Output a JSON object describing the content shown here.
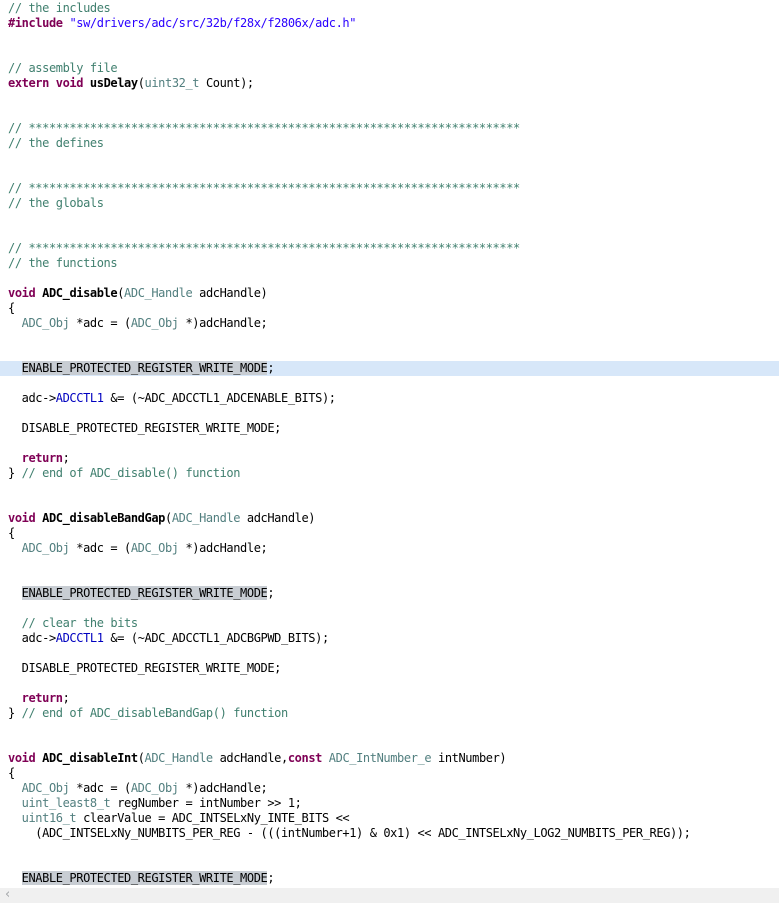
{
  "app": {
    "kind": "code-editor",
    "language": "C",
    "file_topic": "TI f2806x ADC driver source"
  },
  "palette": {
    "keyword": "#7F0055",
    "comment": "#3F7F6E",
    "string": "#2A00FF",
    "typedef": "#527F7F",
    "field": "#0000C0",
    "occurrence_bg": "#C8CDD3",
    "current_line_bg": "#D7E7F9",
    "scrollbar_bg": "#F0F0F0"
  },
  "scrollbar": {
    "left_arrow": "‹"
  },
  "editor": {
    "lines": [
      {
        "tokens": [
          [
            "com",
            "// the includes"
          ]
        ]
      },
      {
        "tokens": [
          [
            "kw",
            "#include"
          ],
          [
            "pl",
            " "
          ],
          [
            "str",
            "\"sw/drivers/adc/src/32b/f28x/f2806x/adc.h\""
          ]
        ]
      },
      {
        "tokens": []
      },
      {
        "tokens": []
      },
      {
        "tokens": [
          [
            "com",
            "// assembly file"
          ]
        ]
      },
      {
        "tokens": [
          [
            "kw",
            "extern"
          ],
          [
            "pl",
            " "
          ],
          [
            "kw",
            "void"
          ],
          [
            "pl",
            " "
          ],
          [
            "fn",
            "usDelay"
          ],
          [
            "pl",
            "("
          ],
          [
            "typ",
            "uint32_t"
          ],
          [
            "pl",
            " Count);"
          ]
        ]
      },
      {
        "tokens": []
      },
      {
        "tokens": []
      },
      {
        "tokens": [
          [
            "com",
            "// ************************************************************************"
          ]
        ]
      },
      {
        "tokens": [
          [
            "com",
            "// the defines"
          ]
        ]
      },
      {
        "tokens": []
      },
      {
        "tokens": []
      },
      {
        "tokens": [
          [
            "com",
            "// ************************************************************************"
          ]
        ]
      },
      {
        "tokens": [
          [
            "com",
            "// the globals"
          ]
        ]
      },
      {
        "tokens": []
      },
      {
        "tokens": []
      },
      {
        "tokens": [
          [
            "com",
            "// ************************************************************************"
          ]
        ]
      },
      {
        "tokens": [
          [
            "com",
            "// the functions"
          ]
        ]
      },
      {
        "tokens": []
      },
      {
        "tokens": [
          [
            "kw",
            "void"
          ],
          [
            "pl",
            " "
          ],
          [
            "fn",
            "ADC_disable"
          ],
          [
            "pl",
            "("
          ],
          [
            "typ",
            "ADC_Handle"
          ],
          [
            "pl",
            " adcHandle)"
          ]
        ]
      },
      {
        "tokens": [
          [
            "pl",
            "{"
          ]
        ]
      },
      {
        "tokens": [
          [
            "pl",
            "  "
          ],
          [
            "typ",
            "ADC_Obj"
          ],
          [
            "pl",
            " *adc = ("
          ],
          [
            "typ",
            "ADC_Obj"
          ],
          [
            "pl",
            " *)adcHandle;"
          ]
        ]
      },
      {
        "tokens": []
      },
      {
        "tokens": []
      },
      {
        "highlight": "line",
        "tokens": [
          [
            "pl",
            "  "
          ],
          [
            "occ",
            "ENABLE_PROTECTED_REGISTER_WRITE_MODE"
          ],
          [
            "pl",
            ";"
          ]
        ]
      },
      {
        "tokens": []
      },
      {
        "tokens": [
          [
            "pl",
            "  adc->"
          ],
          [
            "field",
            "ADCCTL1"
          ],
          [
            "pl",
            " &= (~ADC_ADCCTL1_ADCENABLE_BITS);"
          ]
        ]
      },
      {
        "tokens": []
      },
      {
        "tokens": [
          [
            "pl",
            "  DISABLE_PROTECTED_REGISTER_WRITE_MODE;"
          ]
        ]
      },
      {
        "tokens": []
      },
      {
        "tokens": [
          [
            "pl",
            "  "
          ],
          [
            "kw",
            "return"
          ],
          [
            "pl",
            ";"
          ]
        ]
      },
      {
        "tokens": [
          [
            "pl",
            "} "
          ],
          [
            "com",
            "// end of ADC_disable() function"
          ]
        ]
      },
      {
        "tokens": []
      },
      {
        "tokens": []
      },
      {
        "tokens": [
          [
            "kw",
            "void"
          ],
          [
            "pl",
            " "
          ],
          [
            "fn",
            "ADC_disableBandGap"
          ],
          [
            "pl",
            "("
          ],
          [
            "typ",
            "ADC_Handle"
          ],
          [
            "pl",
            " adcHandle)"
          ]
        ]
      },
      {
        "tokens": [
          [
            "pl",
            "{"
          ]
        ]
      },
      {
        "tokens": [
          [
            "pl",
            "  "
          ],
          [
            "typ",
            "ADC_Obj"
          ],
          [
            "pl",
            " *adc = ("
          ],
          [
            "typ",
            "ADC_Obj"
          ],
          [
            "pl",
            " *)adcHandle;"
          ]
        ]
      },
      {
        "tokens": []
      },
      {
        "tokens": []
      },
      {
        "tokens": [
          [
            "pl",
            "  "
          ],
          [
            "occ",
            "ENABLE_PROTECTED_REGISTER_WRITE_MODE"
          ],
          [
            "pl",
            ";"
          ]
        ]
      },
      {
        "tokens": []
      },
      {
        "tokens": [
          [
            "pl",
            "  "
          ],
          [
            "com",
            "// clear the bits"
          ]
        ]
      },
      {
        "tokens": [
          [
            "pl",
            "  adc->"
          ],
          [
            "field",
            "ADCCTL1"
          ],
          [
            "pl",
            " &= (~ADC_ADCCTL1_ADCBGPWD_BITS);"
          ]
        ]
      },
      {
        "tokens": []
      },
      {
        "tokens": [
          [
            "pl",
            "  DISABLE_PROTECTED_REGISTER_WRITE_MODE;"
          ]
        ]
      },
      {
        "tokens": []
      },
      {
        "tokens": [
          [
            "pl",
            "  "
          ],
          [
            "kw",
            "return"
          ],
          [
            "pl",
            ";"
          ]
        ]
      },
      {
        "tokens": [
          [
            "pl",
            "} "
          ],
          [
            "com",
            "// end of ADC_disableBandGap() function"
          ]
        ]
      },
      {
        "tokens": []
      },
      {
        "tokens": []
      },
      {
        "tokens": [
          [
            "kw",
            "void"
          ],
          [
            "pl",
            " "
          ],
          [
            "fn",
            "ADC_disableInt"
          ],
          [
            "pl",
            "("
          ],
          [
            "typ",
            "ADC_Handle"
          ],
          [
            "pl",
            " adcHandle,"
          ],
          [
            "kw",
            "const"
          ],
          [
            "pl",
            " "
          ],
          [
            "typ",
            "ADC_IntNumber_e"
          ],
          [
            "pl",
            " intNumber)"
          ]
        ]
      },
      {
        "tokens": [
          [
            "pl",
            "{"
          ]
        ]
      },
      {
        "tokens": [
          [
            "pl",
            "  "
          ],
          [
            "typ",
            "ADC_Obj"
          ],
          [
            "pl",
            " *adc = ("
          ],
          [
            "typ",
            "ADC_Obj"
          ],
          [
            "pl",
            " *)adcHandle;"
          ]
        ]
      },
      {
        "tokens": [
          [
            "pl",
            "  "
          ],
          [
            "typ",
            "uint_least8_t"
          ],
          [
            "pl",
            " regNumber = intNumber >> 1;"
          ]
        ]
      },
      {
        "tokens": [
          [
            "pl",
            "  "
          ],
          [
            "typ",
            "uint16_t"
          ],
          [
            "pl",
            " clearValue = ADC_INTSELxNy_INTE_BITS <<"
          ]
        ]
      },
      {
        "tokens": [
          [
            "pl",
            "    (ADC_INTSELxNy_NUMBITS_PER_REG - (((intNumber+1) & 0x1) << ADC_INTSELxNy_LOG2_NUMBITS_PER_REG));"
          ]
        ]
      },
      {
        "tokens": []
      },
      {
        "tokens": []
      },
      {
        "tokens": [
          [
            "pl",
            "  "
          ],
          [
            "occ",
            "ENABLE_PROTECTED_REGISTER_WRITE_MODE"
          ],
          [
            "pl",
            ";"
          ]
        ]
      }
    ]
  }
}
